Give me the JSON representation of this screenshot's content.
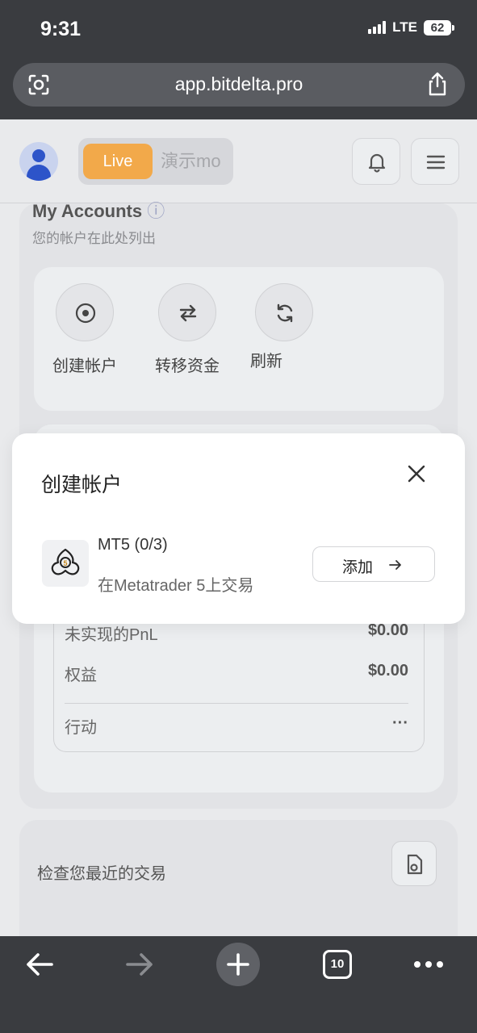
{
  "status_bar": {
    "time": "9:31",
    "network": "LTE",
    "battery": "62"
  },
  "browser": {
    "url": "app.bitdelta.pro",
    "tab_count": "10"
  },
  "header": {
    "mode_live": "Live",
    "mode_demo": "演示mo"
  },
  "accounts": {
    "title": "My Accounts",
    "subtitle": "您的帐户在此处列出",
    "actions": [
      {
        "label": "创建帐户"
      },
      {
        "label": "转移资金"
      },
      {
        "label": "刷新"
      }
    ]
  },
  "stats": {
    "rows": [
      {
        "label": "未实现的PnL",
        "value": "$0.00"
      },
      {
        "label": "权益",
        "value": "$0.00"
      },
      {
        "label": "行动",
        "value": "···"
      }
    ]
  },
  "transactions": {
    "title": "检查您最近的交易"
  },
  "modal": {
    "title": "创建帐户",
    "platform_name": "MT5 (0/3)",
    "platform_desc": "在Metatrader 5上交易",
    "add_label": "添加"
  }
}
